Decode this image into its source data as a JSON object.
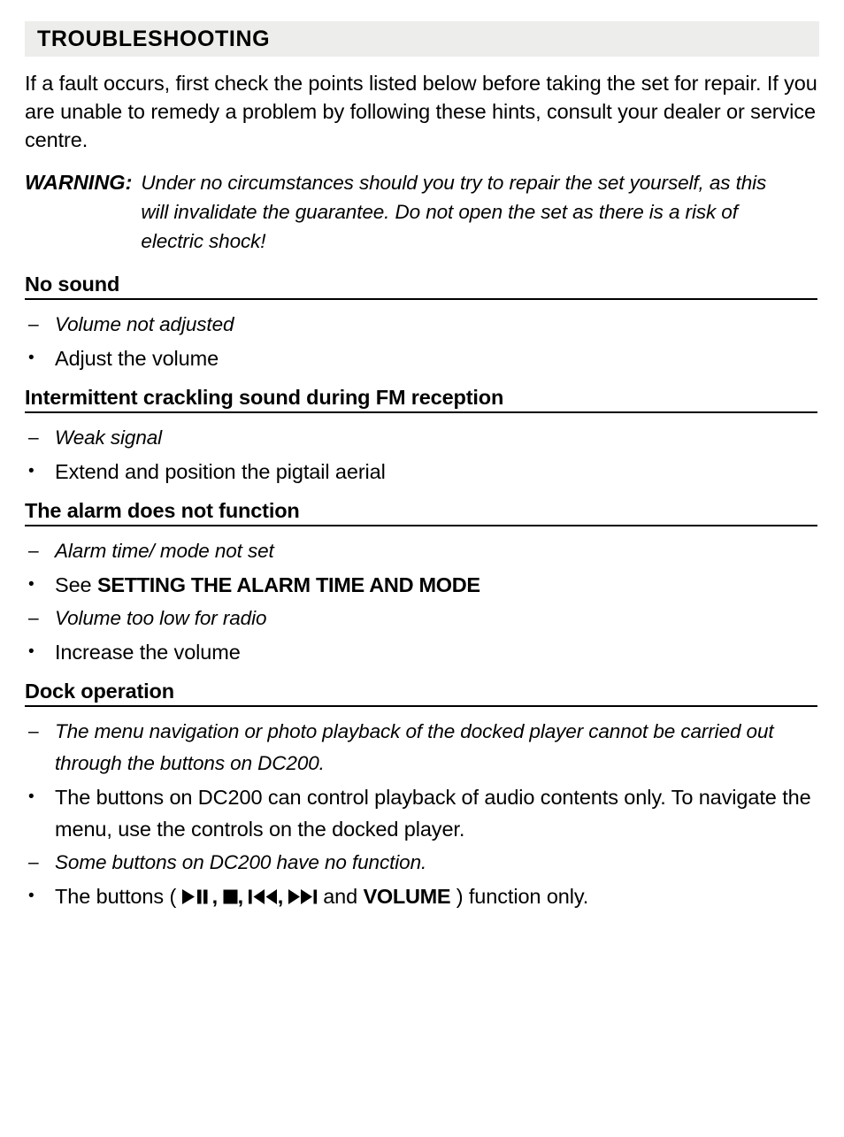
{
  "header": {
    "title": "TROUBLESHOOTING",
    "band_color": "#ededeb"
  },
  "intro": "If a fault occurs, first check the points listed below before taking the set for repair. If you are unable to remedy a problem by following these hints, consult your dealer or service centre.",
  "warning": {
    "label": "WARNING:",
    "body": "Under no circumstances should you try to repair the set yourself, as this will invalidate the guarantee. Do not open the set as there is a risk of electric shock!"
  },
  "sections": [
    {
      "heading": "No sound",
      "items": [
        {
          "marker": "–",
          "type": "problem",
          "text": "Volume not adjusted"
        },
        {
          "marker": "•",
          "type": "solution",
          "text": "Adjust the volume"
        }
      ]
    },
    {
      "heading": "Intermittent crackling sound during FM reception",
      "items": [
        {
          "marker": "–",
          "type": "problem",
          "text": "Weak signal"
        },
        {
          "marker": "•",
          "type": "solution",
          "text": "Extend and position the pigtail aerial"
        }
      ]
    },
    {
      "heading": "The alarm does not function",
      "items": [
        {
          "marker": "–",
          "type": "problem",
          "text": "Alarm time/ mode not set"
        },
        {
          "marker": "•",
          "type": "solution",
          "text_before": "See ",
          "text_strong": "SETTING THE ALARM TIME AND MODE",
          "text": "See SETTING THE ALARM TIME AND MODE"
        },
        {
          "marker": "–",
          "type": "problem",
          "text": "Volume too low for radio"
        },
        {
          "marker": "•",
          "type": "solution",
          "text": "Increase the volume"
        }
      ]
    },
    {
      "heading": "Dock operation",
      "items": [
        {
          "marker": "–",
          "type": "problem",
          "text": "The menu navigation or photo playback of the docked player cannot be carried out through the buttons on DC200."
        },
        {
          "marker": "•",
          "type": "solution",
          "text": "The buttons on DC200 can control playback of audio contents only. To navigate the menu, use the controls on the docked player."
        },
        {
          "marker": "–",
          "type": "problem",
          "text": "Some buttons on DC200 have no function."
        },
        {
          "marker": "•",
          "type": "solution",
          "is_glyph_line": true,
          "text_before": "The buttons ( ",
          "glyph_icons": [
            "play-pause-icon",
            "stop-icon",
            "previous-track-icon",
            "next-track-icon"
          ],
          "text_middle": " and ",
          "text_strong": "VOLUME",
          "text_after": " ) function only.",
          "text": "The buttons ( ▶❙❙, ■, ❘◀◀, ▶▶❘ and VOLUME ) function only."
        }
      ]
    }
  ]
}
